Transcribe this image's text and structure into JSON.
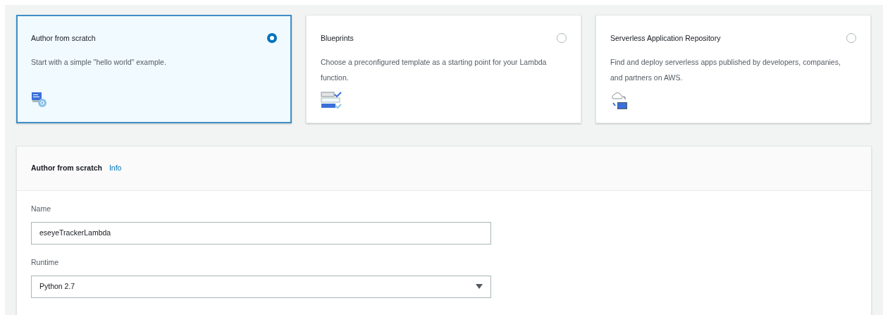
{
  "options": [
    {
      "kind": "scratch",
      "title": "Author from scratch",
      "description": "Start with a simple \"hello world\" example.",
      "selected": true
    },
    {
      "kind": "blueprint",
      "title": "Blueprints",
      "description": "Choose a preconfigured template as a starting point for your Lambda function.",
      "selected": false
    },
    {
      "kind": "repository",
      "title": "Serverless Application Repository",
      "description": "Find and deploy serverless apps published by developers, companies, and partners on AWS.",
      "selected": false
    }
  ],
  "panel": {
    "title": "Author from scratch",
    "info_link": "Info",
    "fields": [
      {
        "kind": "text",
        "label": "Name",
        "value": "eseyeTrackerLambda"
      },
      {
        "kind": "select",
        "label": "Runtime",
        "value": "Python 2.7"
      }
    ]
  }
}
